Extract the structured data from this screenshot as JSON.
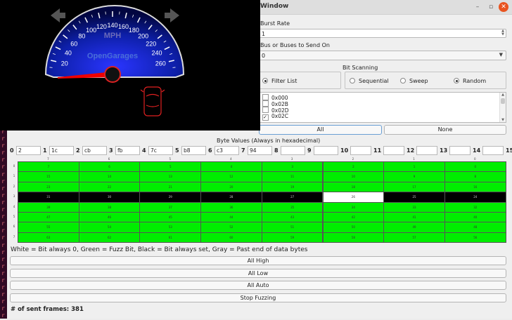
{
  "window": {
    "title": "Window"
  },
  "burst_rate": {
    "label": "Burst Rate",
    "value": "1"
  },
  "bus": {
    "label": "Bus or Buses to Send On",
    "value": "0"
  },
  "filter_list": {
    "label": "Filter List"
  },
  "bit_scanning": {
    "label": "Bit Scanning",
    "options": [
      {
        "label": "Sequential",
        "checked": false
      },
      {
        "label": "Sweep",
        "checked": false
      },
      {
        "label": "Random",
        "checked": true
      }
    ]
  },
  "ids": [
    {
      "label": "0x000",
      "checked": false
    },
    {
      "label": "0x02B",
      "checked": false
    },
    {
      "label": "0x02D",
      "checked": false
    },
    {
      "label": "0x02C",
      "checked": true
    }
  ],
  "buttons": {
    "all": "All",
    "none": "None",
    "all_high": "All High",
    "all_low": "All Low",
    "all_auto": "All Auto",
    "stop": "Stop Fuzzing"
  },
  "byte_values": {
    "title": "Byte Values (Always in hexadecimal)",
    "indices": [
      "0",
      "1",
      "2",
      "3",
      "4",
      "5",
      "6",
      "7",
      "8",
      "9",
      "10",
      "11",
      "12",
      "13",
      "14",
      "15"
    ],
    "values": [
      "2",
      "1c",
      "cb",
      "fb",
      "7c",
      "b8",
      "c3",
      "94",
      "",
      "",
      "",
      "",
      "",
      "",
      "",
      ""
    ]
  },
  "grid": {
    "col_headers": [
      "7",
      "6",
      "5",
      "4",
      "3",
      "2",
      "1",
      "0"
    ],
    "row_headers": [
      "0",
      "1",
      "2",
      "3",
      "4",
      "5",
      "6",
      "7"
    ],
    "cells": [
      [
        "7",
        "6",
        "5",
        "4",
        "3",
        "2",
        "1",
        "0"
      ],
      [
        "15",
        "14",
        "13",
        "12",
        "11",
        "10",
        "9",
        "8"
      ],
      [
        "23",
        "22",
        "21",
        "20",
        "19",
        "18",
        "17",
        "16"
      ],
      [
        "31",
        "30",
        "29",
        "28",
        "27",
        "26",
        "25",
        "24"
      ],
      [
        "39",
        "38",
        "37",
        "36",
        "35",
        "34",
        "33",
        "32"
      ],
      [
        "47",
        "46",
        "45",
        "44",
        "43",
        "42",
        "41",
        "40"
      ],
      [
        "55",
        "54",
        "53",
        "52",
        "51",
        "50",
        "49",
        "48"
      ],
      [
        "63",
        "62",
        "61",
        "60",
        "59",
        "58",
        "57",
        "56"
      ]
    ],
    "states": [
      [
        "G",
        "G",
        "G",
        "G",
        "G",
        "G",
        "G",
        "G"
      ],
      [
        "G",
        "G",
        "G",
        "G",
        "G",
        "G",
        "G",
        "G"
      ],
      [
        "G",
        "G",
        "G",
        "G",
        "G",
        "G",
        "G",
        "G"
      ],
      [
        "B",
        "B",
        "B",
        "B",
        "B",
        "W",
        "B",
        "B"
      ],
      [
        "G",
        "G",
        "G",
        "G",
        "G",
        "G",
        "G",
        "G"
      ],
      [
        "G",
        "G",
        "G",
        "G",
        "G",
        "G",
        "G",
        "G"
      ],
      [
        "G",
        "G",
        "G",
        "G",
        "G",
        "G",
        "G",
        "G"
      ],
      [
        "G",
        "G",
        "G",
        "G",
        "G",
        "G",
        "G",
        "G"
      ]
    ],
    "colors": {
      "G": "#00ee00",
      "B": "#000000",
      "W": "#ffffff"
    }
  },
  "legend": "White = Bit always 0, Green = Fuzz Bit, Black = Bit always set, Gray = Past end of data bytes",
  "sent_frames": "# of sent frames: 381",
  "gauge": {
    "unit": "MPH",
    "brand": "OpenGarages",
    "ticks": [
      "20",
      "40",
      "60",
      "80",
      "100",
      "120",
      "140",
      "160",
      "180",
      "200",
      "220",
      "240",
      "260"
    ],
    "needle_value": 0
  },
  "terminal_strip": {
    "chars": "r"
  }
}
